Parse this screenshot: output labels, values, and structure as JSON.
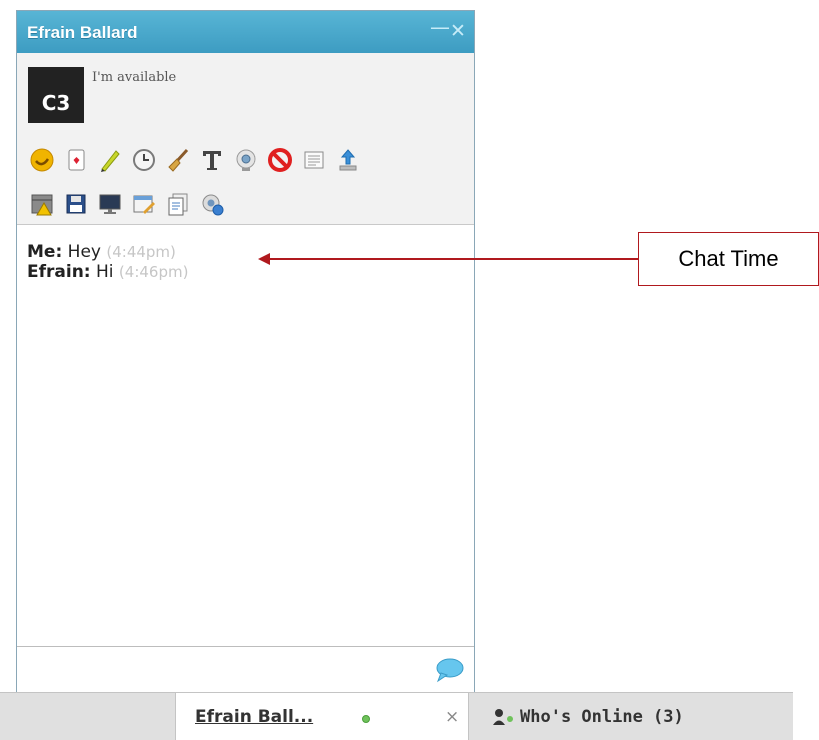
{
  "window": {
    "title": "Efrain Ballard",
    "minimize_glyph": "—",
    "close_glyph": "✕"
  },
  "profile": {
    "avatar_text": "C3",
    "status_message": "I'm available"
  },
  "toolbar": {
    "row1": [
      "emoticon-icon",
      "card-icon",
      "pencil-icon",
      "clock-icon",
      "broom-icon",
      "text-format-icon",
      "webcam-icon",
      "block-icon",
      "list-icon",
      "upload-icon"
    ],
    "row2": [
      "calendar-warning-icon",
      "save-icon",
      "monitor-icon",
      "edit-window-icon",
      "documents-icon",
      "webcam-settings-icon"
    ]
  },
  "messages": [
    {
      "sender": "Me:",
      "text": "Hey",
      "time": "(4:44pm)"
    },
    {
      "sender": "Efrain:",
      "text": "Hi",
      "time": "(4:46pm)"
    }
  ],
  "input": {
    "placeholder": "",
    "send_icon": "speech-bubble-icon"
  },
  "taskbar": {
    "tab_name": "Efrain Ball...",
    "tab_close": "×",
    "whos_online": "Who's Online (3)"
  },
  "annotation": {
    "label": "Chat Time"
  },
  "colors": {
    "titlebar": "#4aa9cd",
    "annotation": "#b0191e",
    "timestamp": "#c6c6c6",
    "online": "#6fc25b"
  }
}
